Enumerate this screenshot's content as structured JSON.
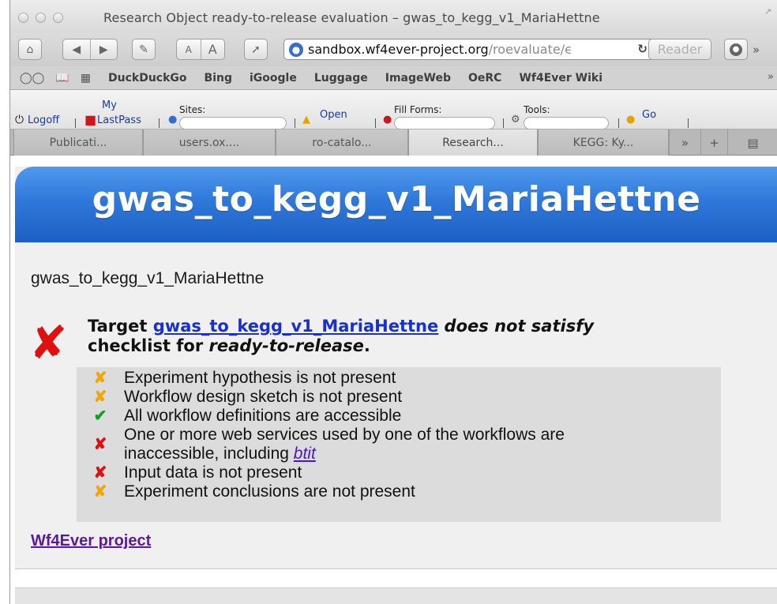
{
  "window": {
    "title": "Research Object ready-to-release evaluation – gwas_to_kegg_v1_MariaHettne"
  },
  "toolbar": {
    "font_small": "A",
    "font_large": "A",
    "url_host": "sandbox.wf4ever-project.org",
    "url_path": "/roevaluate/ϵ",
    "reader_label": "Reader"
  },
  "bookmarks": [
    "DuckDuckGo",
    "Bing",
    "iGoogle",
    "Luggage",
    "ImageWeb",
    "OeRC",
    "Wf4Ever Wiki"
  ],
  "lastpass": {
    "logoff": "Logoff",
    "my_label": "My",
    "lastpass_label": "LastPass",
    "sites": "Sites:",
    "open": "Open",
    "fill_forms": "Fill Forms:",
    "tools": "Tools:",
    "go": "Go"
  },
  "tabs": [
    {
      "label": "Publicati..."
    },
    {
      "label": "users.ox...."
    },
    {
      "label": "ro-catalo..."
    },
    {
      "label": "Research..."
    },
    {
      "label": "KEGG: Ky..."
    }
  ],
  "page": {
    "banner_title": "gwas_to_kegg_v1_MariaHettne",
    "subtitle": "gwas_to_kegg_v1_MariaHettne",
    "verdict": {
      "prefix": "Target ",
      "target_link": "gwas_to_kegg_v1_MariaHettne",
      "middle": " does not satisfy",
      "line2": "checklist for ",
      "checklist_name": "ready-to-release",
      "suffix": "."
    },
    "checklist": [
      {
        "status": "warn",
        "mark": "✘",
        "text": "Experiment hypothesis is not present"
      },
      {
        "status": "warn",
        "mark": "✘",
        "text": "Workflow design sketch is not present"
      },
      {
        "status": "ok",
        "mark": "✔",
        "text": "All workflow definitions are accessible"
      },
      {
        "status": "fail",
        "mark": "✘",
        "text": "One or more web services used by one of the workflows are",
        "text2": "inaccessible, including ",
        "link": "btit"
      },
      {
        "status": "fail",
        "mark": "✘",
        "text": "Input data is not present"
      },
      {
        "status": "warn",
        "mark": "✘",
        "text": "Experiment conclusions are not present"
      }
    ],
    "footer_link": "Wf4Ever project"
  },
  "colors": {
    "banner": "#2f78d9",
    "fail": "#e01010",
    "warn": "#f2a800",
    "ok": "#11a01b",
    "link": "#1a2fd0",
    "visited_link": "#5b1a9e"
  }
}
